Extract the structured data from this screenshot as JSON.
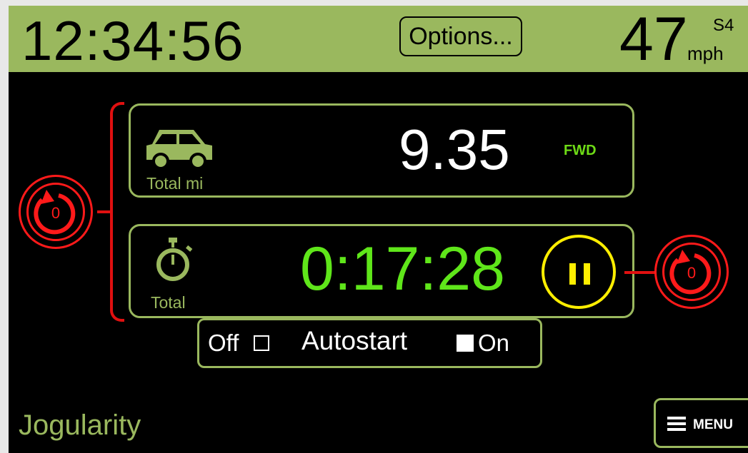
{
  "header": {
    "clock": "12:34:56",
    "options_label": "Options...",
    "speed_value": "47",
    "speed_unit": "mph",
    "speed_prefix": "S4"
  },
  "distance": {
    "label": "Total mi",
    "value": "9.35",
    "direction": "FWD",
    "icon": "car-icon"
  },
  "timer": {
    "label": "Total",
    "value": "0:17:28",
    "icon": "stopwatch-icon",
    "pause_icon": "pause-icon"
  },
  "reset": {
    "left_count": "0",
    "right_count": "0"
  },
  "autostart": {
    "off_label": "Off",
    "label": "Autostart",
    "on_label": "On",
    "state": "On"
  },
  "footer": {
    "app_name": "Jogularity",
    "menu_label": "MENU"
  },
  "colors": {
    "accent_green": "#9ab85e",
    "timer_green": "#5fe61a",
    "reset_red": "#ff1a1a",
    "pause_yellow": "#ffee00",
    "background": "#000000"
  }
}
